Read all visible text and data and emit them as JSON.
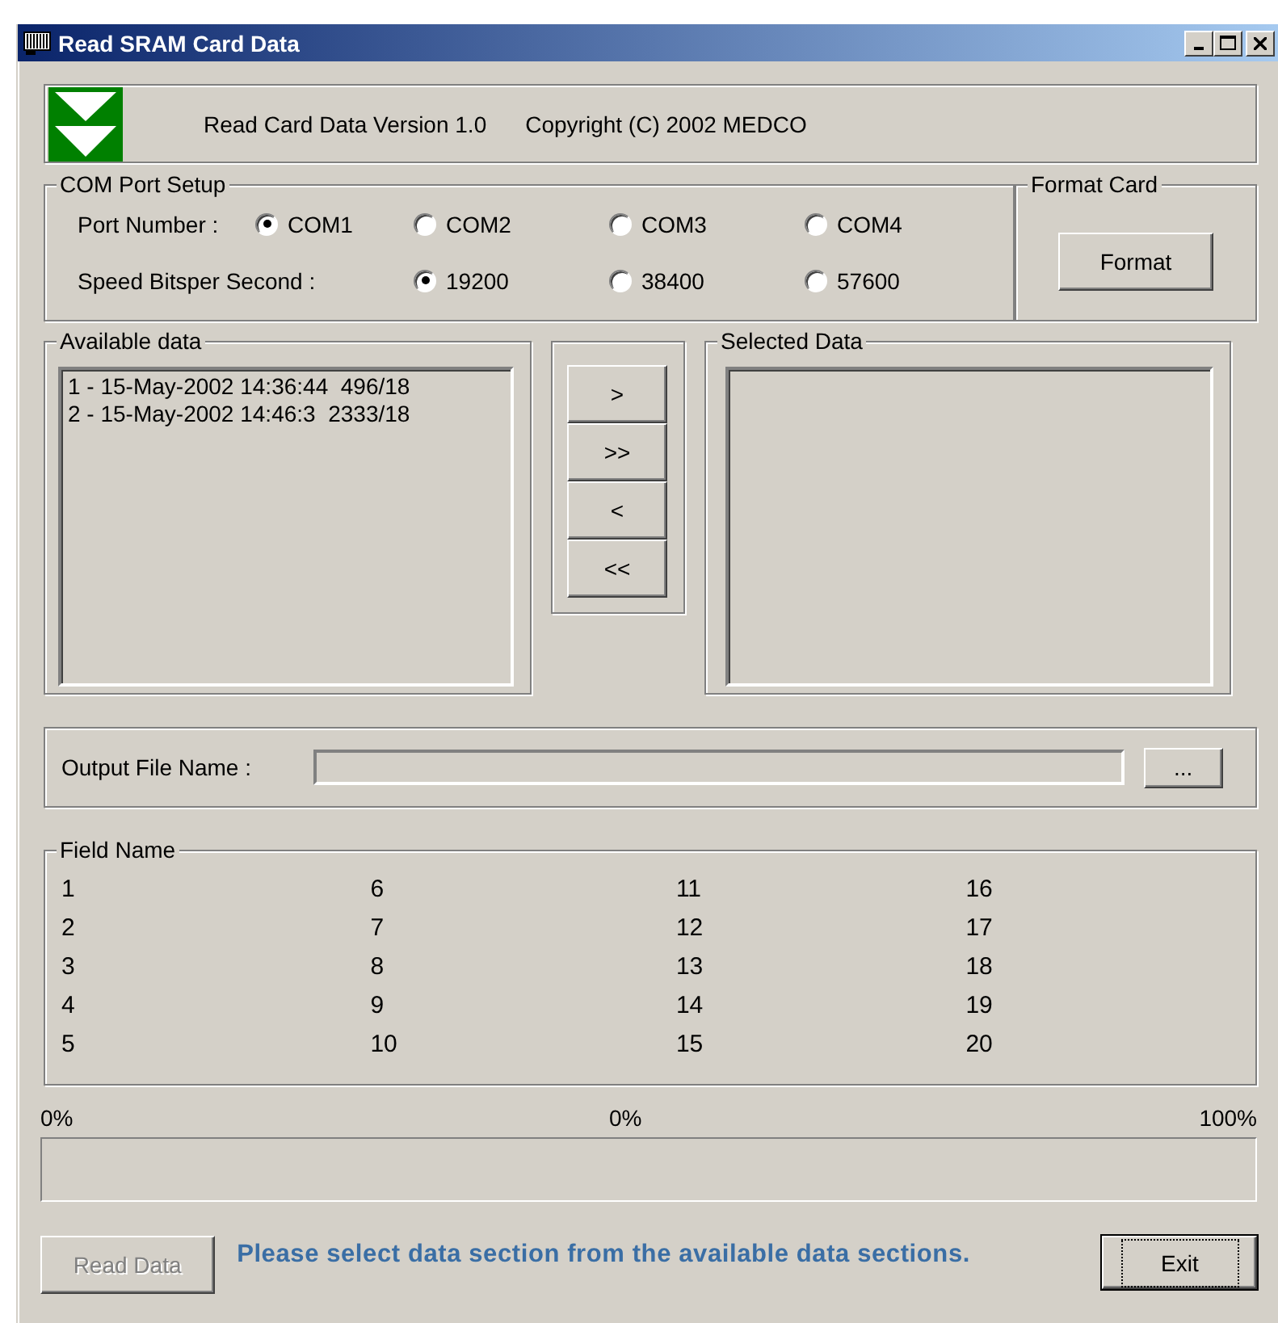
{
  "window": {
    "title": "Read SRAM Card Data"
  },
  "header": {
    "version": "Read Card Data Version 1.0",
    "copyright": "Copyright (C) 2002 MEDCO"
  },
  "com_port_setup": {
    "title": "COM Port Setup",
    "port_label": "Port Number :",
    "speed_label": "Speed Bitsper Second :",
    "ports": [
      {
        "label": "COM1",
        "selected": true
      },
      {
        "label": "COM2",
        "selected": false
      },
      {
        "label": "COM3",
        "selected": false
      },
      {
        "label": "COM4",
        "selected": false
      }
    ],
    "speeds": [
      {
        "label": "19200",
        "selected": true
      },
      {
        "label": "38400",
        "selected": false
      },
      {
        "label": "57600",
        "selected": false
      }
    ]
  },
  "format_card": {
    "title": "Format Card",
    "button": "Format"
  },
  "available_data": {
    "title": "Available data",
    "items": [
      "1 - 15-May-2002 14:36:44  496/18",
      "2 - 15-May-2002 14:46:3  2333/18"
    ]
  },
  "move_buttons": [
    ">",
    ">>",
    "<",
    "<<"
  ],
  "selected_data": {
    "title": "Selected Data"
  },
  "output": {
    "label": "Output File Name :",
    "browse": "..."
  },
  "field_names": {
    "title": "Field Name",
    "columns": [
      [
        "1",
        "2",
        "3",
        "4",
        "5"
      ],
      [
        "6",
        "7",
        "8",
        "9",
        "10"
      ],
      [
        "11",
        "12",
        "13",
        "14",
        "15"
      ],
      [
        "16",
        "17",
        "18",
        "19",
        "20"
      ]
    ]
  },
  "progress": {
    "min": "0%",
    "current": "0%",
    "max": "100%"
  },
  "read_button": {
    "label": "Read Data",
    "disabled": true
  },
  "message": "Please select data section from the available data sections.",
  "exit_button": {
    "label": "Exit"
  }
}
